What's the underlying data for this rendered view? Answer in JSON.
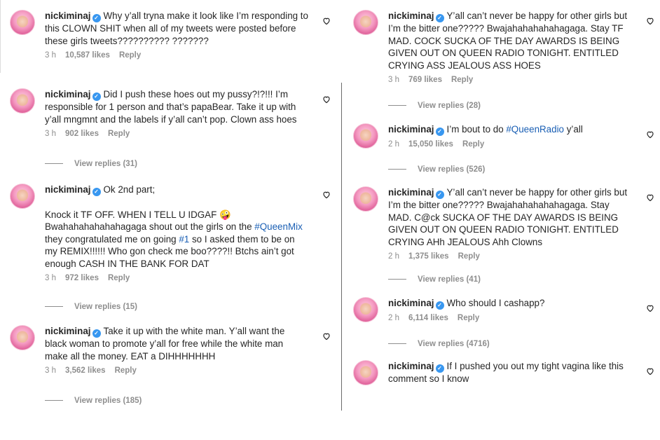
{
  "left": [
    {
      "username": "nickiminaj",
      "segments": [
        {
          "t": "Why y’all tryna make it look like I’m responding to this CLOWN SHIT when all of my tweets were posted before these girls tweets?????????? ???????"
        }
      ],
      "time": "3 h",
      "likes": "10,587 likes",
      "reply": "Reply",
      "view_replies": ""
    },
    {
      "username": "nickiminaj",
      "segments": [
        {
          "t": "Did I push these hoes out my pussy?!?!!! I’m responsible for 1 person and that’s papaBear. Take it up with y’all mngmnt and the labels if y’all can’t pop. Clown ass hoes"
        }
      ],
      "time": "3 h",
      "likes": "902 likes",
      "reply": "Reply",
      "view_replies": "View replies (31)"
    },
    {
      "username": "nickiminaj",
      "segments": [
        {
          "t": "Ok 2nd part;\n\nKnock it TF OFF. WHEN I TELL U IDGAF 🤪\nBwahahahahahahagaga shout out the girls on the "
        },
        {
          "t": "#QueenMix",
          "tag": true
        },
        {
          "t": " they congratulated me on going "
        },
        {
          "t": "#1",
          "tag": true
        },
        {
          "t": " so I asked them to be on my REMIX!!!!!! Who gon check me boo????!! Btchs ain’t got enough CASH IN THE BANK FOR DAT"
        }
      ],
      "time": "3 h",
      "likes": "972 likes",
      "reply": "Reply",
      "view_replies": "View replies (15)"
    },
    {
      "username": "nickiminaj",
      "segments": [
        {
          "t": "Take it up with the white man. Y’all want the black woman to promote y’all for free while the white man make all the money. EAT a DIHHHHHHH"
        }
      ],
      "time": "3 h",
      "likes": "3,562 likes",
      "reply": "Reply",
      "view_replies": "View replies (185)"
    }
  ],
  "right": [
    {
      "username": "nickiminaj",
      "segments": [
        {
          "t": "Y’all can’t never be happy for other girls but I’m the bitter one????? Bwajahahahahahagaga. Stay TF MAD. COCK SUCKA OF THE DAY AWARDS IS BEING GIVEN OUT ON QUEEN RADIO TONIGHT. ENTITLED CRYING ASS JEALOUS ASS HOES"
        }
      ],
      "time": "3 h",
      "likes": "769 likes",
      "reply": "Reply",
      "view_replies": "View replies (28)"
    },
    {
      "username": "nickiminaj",
      "segments": [
        {
          "t": "I’m bout to do "
        },
        {
          "t": "#QueenRadio",
          "tag": true
        },
        {
          "t": " y’all"
        }
      ],
      "time": "2 h",
      "likes": "15,050 likes",
      "reply": "Reply",
      "view_replies": "View replies (526)"
    },
    {
      "username": "nickiminaj",
      "segments": [
        {
          "t": "Y’all can’t never be happy for other girls but I’m the bitter one????? Bwajahahahahahagaga. Stay MAD. C@ck SUCKA OF THE DAY AWARDS IS BEING GIVEN OUT ON QUEEN RADIO TONIGHT. ENTITLED CRYING AHh JEALOUS Ahh Clowns"
        }
      ],
      "time": "2 h",
      "likes": "1,375 likes",
      "reply": "Reply",
      "view_replies": "View replies (41)"
    },
    {
      "username": "nickiminaj",
      "segments": [
        {
          "t": "Who should I cashapp?"
        }
      ],
      "time": "2 h",
      "likes": "6,114 likes",
      "reply": "Reply",
      "view_replies": "View replies (4716)"
    },
    {
      "username": "nickiminaj",
      "segments": [
        {
          "t": "If I pushed you out my tight vagina like this comment so I know"
        }
      ],
      "time": "",
      "likes": "",
      "reply": "",
      "view_replies": ""
    }
  ],
  "icons": {
    "verified": "verified-badge-icon",
    "like": "heart-outline-icon"
  },
  "colors": {
    "username": "#262626",
    "meta": "#8e8e8e",
    "hashtag": "#1a5fb4",
    "verified": "#3897f0"
  }
}
